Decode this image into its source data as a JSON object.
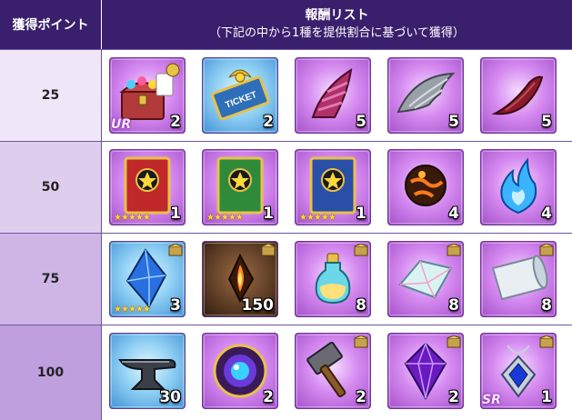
{
  "header": {
    "points_label": "獲得ポイント",
    "rewards_title": "報酬リスト",
    "rewards_subtitle": "（下記の中から1種を提供割合に基づいて獲得）"
  },
  "rows": [
    {
      "points": "25",
      "items": [
        {
          "name": "treasure-chest",
          "qty": "2",
          "rarity": "UR",
          "frame": "purple"
        },
        {
          "name": "ticket",
          "qty": "2",
          "frame": "blue"
        },
        {
          "name": "spiral-horn",
          "qty": "5",
          "frame": "purple"
        },
        {
          "name": "grey-wing",
          "qty": "5",
          "frame": "purple"
        },
        {
          "name": "red-claw",
          "qty": "5",
          "frame": "purple"
        }
      ]
    },
    {
      "points": "50",
      "items": [
        {
          "name": "red-star-book",
          "qty": "1",
          "stars": "★★★★★",
          "frame": "purple"
        },
        {
          "name": "green-star-book",
          "qty": "1",
          "stars": "★★★★★",
          "frame": "purple"
        },
        {
          "name": "blue-star-book",
          "qty": "1",
          "stars": "★★★★★",
          "frame": "purple"
        },
        {
          "name": "fire-orb",
          "qty": "4",
          "frame": "purple"
        },
        {
          "name": "blue-flame",
          "qty": "4",
          "frame": "purple"
        }
      ]
    },
    {
      "points": "75",
      "items": [
        {
          "name": "blue-crystal",
          "qty": "3",
          "stars": "★★★★★",
          "frame": "blue",
          "badge": true
        },
        {
          "name": "flame-shard",
          "qty": "150",
          "frame": "dark",
          "badge": true
        },
        {
          "name": "potion-bottle",
          "qty": "8",
          "frame": "purple",
          "badge": true
        },
        {
          "name": "rainbow-crystal",
          "qty": "8",
          "frame": "purple",
          "badge": true
        },
        {
          "name": "silver-scroll",
          "qty": "8",
          "frame": "purple",
          "badge": true
        }
      ]
    },
    {
      "points": "100",
      "items": [
        {
          "name": "anvil",
          "qty": "30",
          "frame": "blue"
        },
        {
          "name": "magic-orb-seal",
          "qty": "2",
          "frame": "purple"
        },
        {
          "name": "hammer",
          "qty": "2",
          "frame": "purple",
          "badge": true
        },
        {
          "name": "purple-gem",
          "qty": "2",
          "frame": "purple",
          "badge": true
        },
        {
          "name": "sapphire-pendant",
          "qty": "1",
          "rarity": "SR",
          "frame": "purple",
          "badge": true
        }
      ]
    }
  ],
  "colors": {
    "header_bg": "#3a1f6d",
    "row_bg": [
      "#efe6f7",
      "#dfcdee",
      "#cfb5e6",
      "#bf9fde"
    ]
  }
}
